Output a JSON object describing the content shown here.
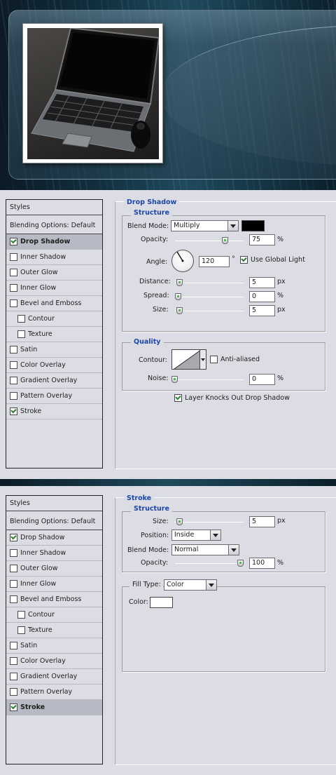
{
  "hero": {
    "image_alt": "laptop-photo"
  },
  "dialog1": {
    "styles_header": "Styles",
    "blending_options": "Blending Options: Default",
    "style_items": [
      {
        "label": "Drop Shadow",
        "checked": true,
        "selected": true,
        "indent": false
      },
      {
        "label": "Inner Shadow",
        "checked": false,
        "selected": false,
        "indent": false
      },
      {
        "label": "Outer Glow",
        "checked": false,
        "selected": false,
        "indent": false
      },
      {
        "label": "Inner Glow",
        "checked": false,
        "selected": false,
        "indent": false
      },
      {
        "label": "Bevel and Emboss",
        "checked": false,
        "selected": false,
        "indent": false
      },
      {
        "label": "Contour",
        "checked": false,
        "selected": false,
        "indent": true
      },
      {
        "label": "Texture",
        "checked": false,
        "selected": false,
        "indent": true
      },
      {
        "label": "Satin",
        "checked": false,
        "selected": false,
        "indent": false
      },
      {
        "label": "Color Overlay",
        "checked": false,
        "selected": false,
        "indent": false
      },
      {
        "label": "Gradient Overlay",
        "checked": false,
        "selected": false,
        "indent": false
      },
      {
        "label": "Pattern Overlay",
        "checked": false,
        "selected": false,
        "indent": false
      },
      {
        "label": "Stroke",
        "checked": true,
        "selected": false,
        "indent": false
      }
    ],
    "section_title": "Drop Shadow",
    "structure_title": "Structure",
    "blend_mode_label": "Blend Mode:",
    "blend_mode_value": "Multiply",
    "shadow_color": "#000000",
    "opacity_label": "Opacity:",
    "opacity_value": "75",
    "opacity_unit": "%",
    "angle_label": "Angle:",
    "angle_value": "120",
    "angle_unit": "°",
    "use_global_light_label": "Use Global Light",
    "use_global_light_checked": true,
    "distance_label": "Distance:",
    "distance_value": "5",
    "spread_label": "Spread:",
    "spread_value": "0",
    "size_label": "Size:",
    "size_value": "5",
    "unit_px": "px",
    "unit_pct": "%",
    "quality_title": "Quality",
    "contour_label": "Contour:",
    "anti_aliased_label": "Anti-aliased",
    "anti_aliased_checked": false,
    "noise_label": "Noise:",
    "noise_value": "0",
    "knockout_label": "Layer Knocks Out Drop Shadow",
    "knockout_checked": true
  },
  "dialog2": {
    "styles_header": "Styles",
    "blending_options": "Blending Options: Default",
    "style_items": [
      {
        "label": "Drop Shadow",
        "checked": true,
        "selected": false,
        "indent": false
      },
      {
        "label": "Inner Shadow",
        "checked": false,
        "selected": false,
        "indent": false
      },
      {
        "label": "Outer Glow",
        "checked": false,
        "selected": false,
        "indent": false
      },
      {
        "label": "Inner Glow",
        "checked": false,
        "selected": false,
        "indent": false
      },
      {
        "label": "Bevel and Emboss",
        "checked": false,
        "selected": false,
        "indent": false
      },
      {
        "label": "Contour",
        "checked": false,
        "selected": false,
        "indent": true
      },
      {
        "label": "Texture",
        "checked": false,
        "selected": false,
        "indent": true
      },
      {
        "label": "Satin",
        "checked": false,
        "selected": false,
        "indent": false
      },
      {
        "label": "Color Overlay",
        "checked": false,
        "selected": false,
        "indent": false
      },
      {
        "label": "Gradient Overlay",
        "checked": false,
        "selected": false,
        "indent": false
      },
      {
        "label": "Pattern Overlay",
        "checked": false,
        "selected": false,
        "indent": false
      },
      {
        "label": "Stroke",
        "checked": true,
        "selected": true,
        "indent": false
      }
    ],
    "section_title": "Stroke",
    "structure_title": "Structure",
    "size_label": "Size:",
    "size_value": "5",
    "unit_px": "px",
    "position_label": "Position:",
    "position_value": "Inside",
    "blend_mode_label": "Blend Mode:",
    "blend_mode_value": "Normal",
    "opacity_label": "Opacity:",
    "opacity_value": "100",
    "unit_pct": "%",
    "fill_type_label": "Fill Type:",
    "fill_type_value": "Color",
    "color_label": "Color:",
    "stroke_color": "#ffffff"
  }
}
